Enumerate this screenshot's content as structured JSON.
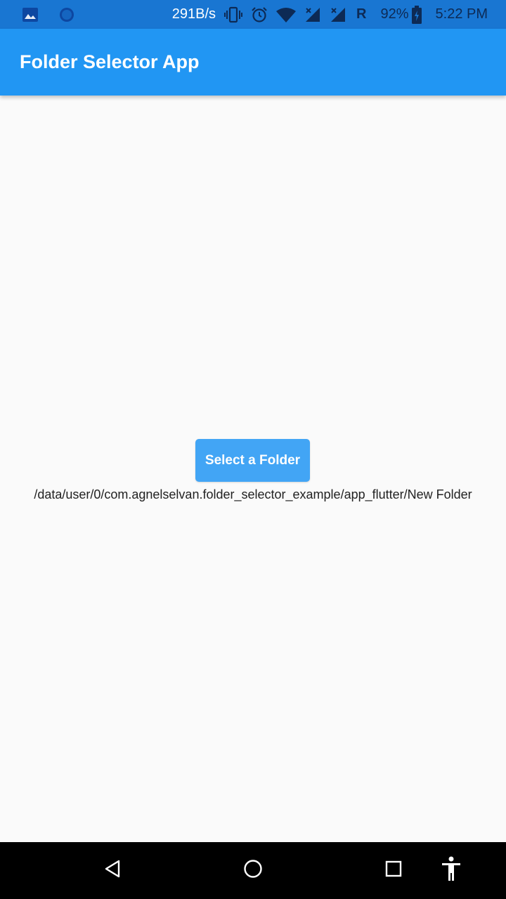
{
  "status_bar": {
    "speed": "291B/s",
    "network": "R",
    "battery": "92%",
    "time": "5:22 PM",
    "icons": [
      "image-icon",
      "circle-app-icon",
      "vibrate-icon",
      "alarm-icon",
      "wifi-icon",
      "signal-x-icon",
      "signal-x-icon",
      "battery-charging-icon"
    ]
  },
  "app_bar": {
    "title": "Folder Selector App"
  },
  "main": {
    "button_label": "Select a Folder",
    "path": "/data/user/0/com.agnelselvan.folder_selector_example/app_flutter/New Folder"
  },
  "nav_bar": {
    "icons": [
      "back-icon",
      "home-icon",
      "recents-icon",
      "accessibility-icon"
    ]
  },
  "colors": {
    "status_bar": "#1976d2",
    "app_bar": "#2196f3",
    "button": "#42a5f5",
    "background": "#fafafa"
  }
}
